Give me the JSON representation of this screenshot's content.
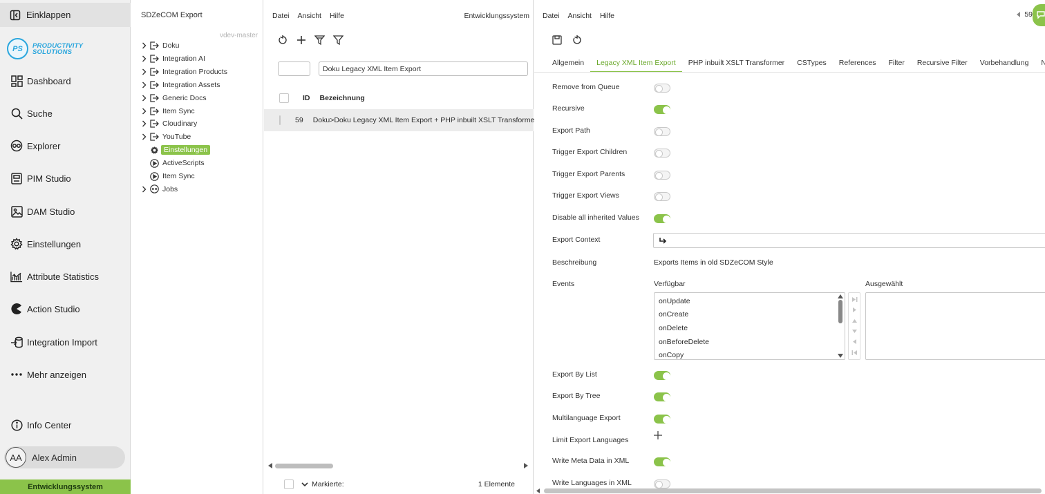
{
  "nav": {
    "collapse_label": "Einklappen",
    "logo_initials": "PS",
    "logo_line1": "PRODUCTIVITY",
    "logo_line2": "SOLUTIONS",
    "items": [
      {
        "label": "Dashboard",
        "icon": "dashboard-icon"
      },
      {
        "label": "Suche",
        "icon": "search-icon"
      },
      {
        "label": "Explorer",
        "icon": "explorer-icon"
      },
      {
        "label": "PIM Studio",
        "icon": "pim-studio-icon"
      },
      {
        "label": "DAM Studio",
        "icon": "image-icon"
      },
      {
        "label": "Einstellungen",
        "icon": "gear-icon"
      },
      {
        "label": "Attribute Statistics",
        "icon": "chart-icon"
      },
      {
        "label": "Action Studio",
        "icon": "pacman-icon"
      },
      {
        "label": "Integration Import",
        "icon": "import-icon"
      },
      {
        "label": "Mehr anzeigen",
        "icon": "more-dots-icon"
      }
    ],
    "info_center": "Info Center",
    "user_initials": "AA",
    "user_name": "Alex Admin",
    "environment": "Entwicklungssystem",
    "accent_color": "#8bc34a"
  },
  "tree": {
    "title": "SDZeCOM Export",
    "branch": "vdev-master",
    "items": [
      {
        "label": "Doku",
        "expandable": true,
        "icon": "export-icon"
      },
      {
        "label": "Integration AI",
        "expandable": true,
        "icon": "export-icon"
      },
      {
        "label": "Integration Products",
        "expandable": true,
        "icon": "export-icon"
      },
      {
        "label": "Integration Assets",
        "expandable": true,
        "icon": "export-icon"
      },
      {
        "label": "Generic Docs",
        "expandable": true,
        "icon": "export-icon"
      },
      {
        "label": "Item Sync",
        "expandable": true,
        "icon": "export-icon"
      },
      {
        "label": "Cloudinary",
        "expandable": true,
        "icon": "export-icon"
      },
      {
        "label": "YouTube",
        "expandable": true,
        "icon": "export-icon"
      },
      {
        "label": "Einstellungen",
        "expandable": false,
        "icon": "gear-icon",
        "selected": true
      },
      {
        "label": "ActiveScripts",
        "expandable": false,
        "icon": "play-circle-icon"
      },
      {
        "label": "Item Sync",
        "expandable": false,
        "icon": "play-circle-icon"
      },
      {
        "label": "Jobs",
        "expandable": true,
        "icon": "jobs-icon"
      }
    ]
  },
  "list": {
    "menu": [
      "Datei",
      "Ansicht",
      "Hilfe"
    ],
    "environment": "Entwicklungssystem",
    "filter_id_value": "",
    "filter_name_value": "Doku Legacy XML Item Export",
    "col_id": "ID",
    "col_name": "Bezeichnung",
    "rows": [
      {
        "id": "59",
        "name": "Doku>Doku Legacy XML Item Export + PHP inbuilt XSLT Transformer"
      }
    ],
    "footer_marked": "Markierte:",
    "footer_count": "1 Elemente"
  },
  "detail": {
    "menu": [
      "Datei",
      "Ansicht",
      "Hilfe"
    ],
    "pager": "59",
    "tabs": [
      "Allgemein",
      "Legacy XML Item Export",
      "PHP inbuilt XSLT Transformer",
      "CSTypes",
      "References",
      "Filter",
      "Recursive Filter",
      "Vorbehandlung",
      "Nachbe"
    ],
    "active_tab": 1,
    "toggles_top": [
      {
        "label": "Remove from Queue",
        "on": false
      },
      {
        "label": "Recursive",
        "on": true
      },
      {
        "label": "Export Path",
        "on": false
      },
      {
        "label": "Trigger Export Children",
        "on": false
      },
      {
        "label": "Trigger Export Parents",
        "on": false
      },
      {
        "label": "Trigger Export Views",
        "on": false
      },
      {
        "label": "Disable all inherited Values",
        "on": true
      }
    ],
    "export_context_label": "Export Context",
    "description_label": "Beschreibung",
    "description_value": "Exports Items in old SDZeCOM Style",
    "events_label": "Events",
    "available_label": "Verfügbar",
    "selected_label": "Ausgewählt",
    "available_events": [
      "onUpdate",
      "onCreate",
      "onDelete",
      "onBeforeDelete",
      "onCopy"
    ],
    "toggles_bottom": [
      {
        "label": "Export By List",
        "on": true
      },
      {
        "label": "Export By Tree",
        "on": true
      },
      {
        "label": "Multilanguage Export",
        "on": true
      }
    ],
    "limit_languages_label": "Limit Export Languages",
    "toggles_last": [
      {
        "label": "Write Meta Data in XML",
        "on": true
      },
      {
        "label": "Write Languages in XML",
        "on": false
      }
    ]
  }
}
